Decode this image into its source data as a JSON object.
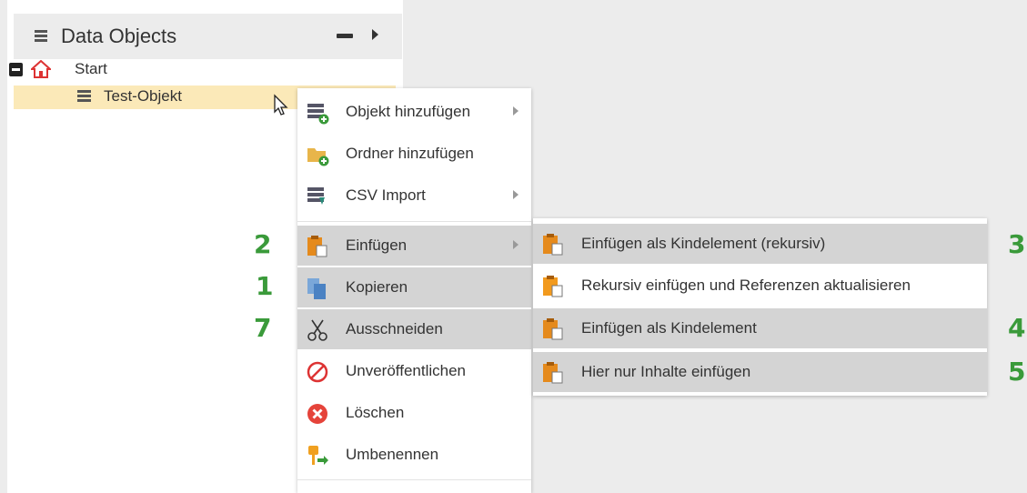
{
  "panel": {
    "title": "Data Objects",
    "tree": {
      "root_label": "Start",
      "child_label": "Test-Objekt"
    }
  },
  "context_menu": {
    "items": [
      {
        "label": "Objekt hinzufügen",
        "icon": "add-object-icon",
        "has_submenu": true
      },
      {
        "label": "Ordner hinzufügen",
        "icon": "add-folder-icon",
        "has_submenu": false
      },
      {
        "label": "CSV Import",
        "icon": "csv-import-icon",
        "has_submenu": true
      },
      {
        "label": "Einfügen",
        "icon": "paste-icon",
        "has_submenu": true,
        "highlighted": true
      },
      {
        "label": "Kopieren",
        "icon": "copy-icon",
        "highlighted": true
      },
      {
        "label": "Ausschneiden",
        "icon": "scissors-icon",
        "highlighted": true
      },
      {
        "label": "Unveröffentlichen",
        "icon": "unpublish-icon"
      },
      {
        "label": "Löschen",
        "icon": "delete-icon"
      },
      {
        "label": "Umbenennen",
        "icon": "rename-icon"
      }
    ]
  },
  "paste_submenu": {
    "items": [
      {
        "label": "Einfügen als Kindelement (rekursiv)",
        "highlighted": true
      },
      {
        "label": "Rekursiv einfügen und Referenzen aktualisieren",
        "highlighted": false
      },
      {
        "label": "Einfügen als Kindelement",
        "highlighted": true
      },
      {
        "label": "Hier nur Inhalte einfügen",
        "highlighted": true
      }
    ]
  },
  "annotations": {
    "paste": "2",
    "copy": "1",
    "cut": "7",
    "paste_child_recursive": "3",
    "paste_child": "4",
    "paste_contents": "5"
  },
  "colors": {
    "highlight": "#d4d4d4",
    "selected_row": "#fbe9b8",
    "annotation_green": "#3a9a3a",
    "paste_orange": "#e58a1c"
  }
}
